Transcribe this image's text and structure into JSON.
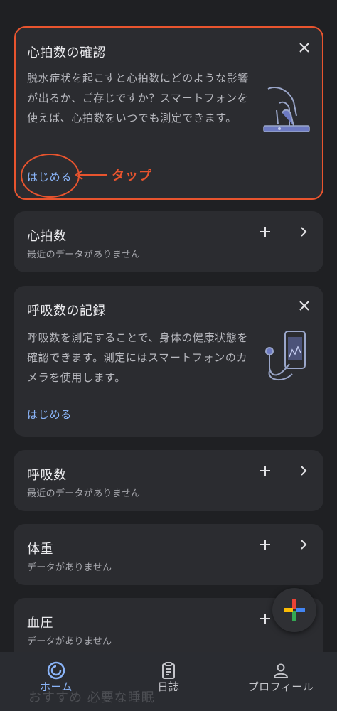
{
  "heart_check_card": {
    "title": "心拍数の確認",
    "body": "脱水症状を起こすと心拍数にどのような影響が出るか、ご存じですか？スマートフォンを使えば、心拍数をいつでも測定できます。",
    "action": "はじめる"
  },
  "annotation": {
    "label": "タップ",
    "color": "#e8542e"
  },
  "metrics": [
    {
      "title": "心拍数",
      "subtitle": "最近のデータがありません"
    },
    {
      "title": "呼吸数",
      "subtitle": "最近のデータがありません"
    },
    {
      "title": "体重",
      "subtitle": "データがありません"
    },
    {
      "title": "血圧",
      "subtitle": "データがありません"
    }
  ],
  "respiration_card": {
    "title": "呼吸数の記録",
    "body": "呼吸数を測定することで、身体の健康状態を確認できます。測定にはスマートフォンのカメラを使用します。",
    "action": "はじめる"
  },
  "fab": {
    "icon": "google-plus-icon"
  },
  "bottom_nav": {
    "items": [
      {
        "label": "ホーム",
        "icon": "home-ring-icon",
        "active": true
      },
      {
        "label": "日誌",
        "icon": "journal-icon",
        "active": false
      },
      {
        "label": "プロフィール",
        "icon": "profile-icon",
        "active": false
      }
    ]
  },
  "behind_nav_text": "おすすめ  必要な睡眠",
  "colors": {
    "background": "#1f2023",
    "card": "#2b2c30",
    "accent": "#8ab4f8",
    "annotation": "#e8542e"
  }
}
